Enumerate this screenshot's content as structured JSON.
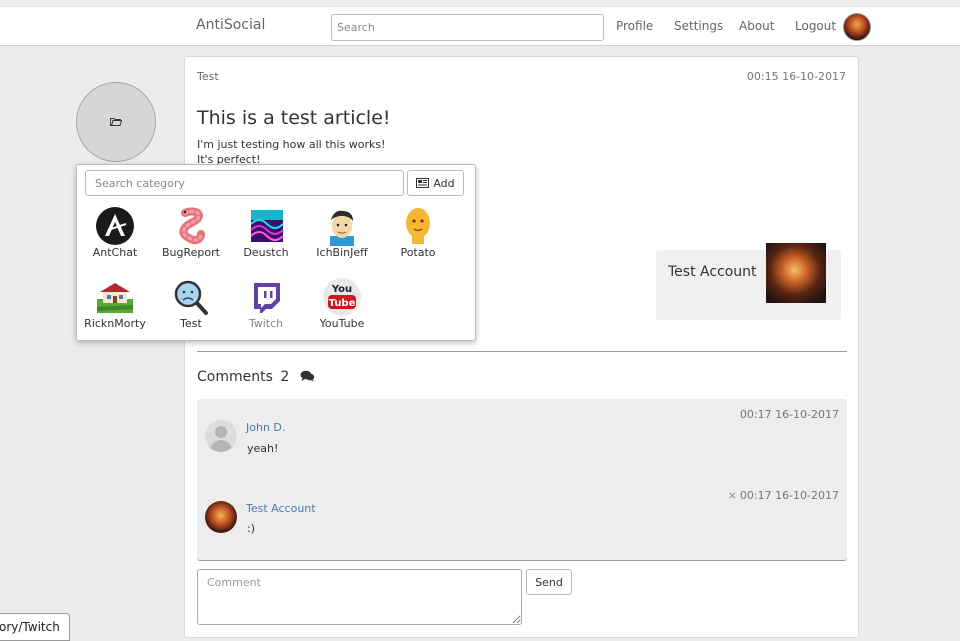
{
  "nav": {
    "brand": "AntiSocial",
    "search_placeholder": "Search",
    "links": [
      "Profile",
      "Settings",
      "About",
      "Logout"
    ]
  },
  "profile": {
    "folder_icon": "folder-icon"
  },
  "post": {
    "category": "Test",
    "date": "00:15 16-10-2017",
    "title": "This is a test article!",
    "body_lines": [
      "I'm just testing how all this works!",
      "It's perfect!"
    ],
    "author": "Test Account"
  },
  "comments": {
    "title": "Comments",
    "count": "2",
    "items": [
      {
        "author": "John D.",
        "text": "yeah!",
        "date": "00:17 16-10-2017",
        "deletable": false
      },
      {
        "author": "Test Account",
        "text": ":)",
        "date": "00:17 16-10-2017",
        "deletable": true,
        "delete_label": "×"
      }
    ],
    "input_placeholder": "Comment",
    "send_label": "Send"
  },
  "category_popup": {
    "search_placeholder": "Search category",
    "add_label": "Add",
    "items": [
      {
        "name": "AntChat",
        "icon": "antchat-logo"
      },
      {
        "name": "BugReport",
        "icon": "worm-icon"
      },
      {
        "name": "Deustch",
        "icon": "neon-wave-icon"
      },
      {
        "name": "IchBinJeff",
        "icon": "face-cartoon-icon"
      },
      {
        "name": "Potato",
        "icon": "potato-head-icon"
      },
      {
        "name": "RicknMorty",
        "icon": "farmhouse-icon"
      },
      {
        "name": "Test",
        "icon": "magnifier-sad-icon"
      },
      {
        "name": "Twitch",
        "icon": "twitch-logo",
        "muted": true
      },
      {
        "name": "YouTube",
        "icon": "youtube-logo"
      }
    ]
  },
  "status_bar": {
    "text": "ory/Twitch"
  },
  "colors": {
    "link": "#4f7ab5",
    "background": "#ececec",
    "twitch": "#6441a4",
    "youtube": "#cc181e"
  }
}
